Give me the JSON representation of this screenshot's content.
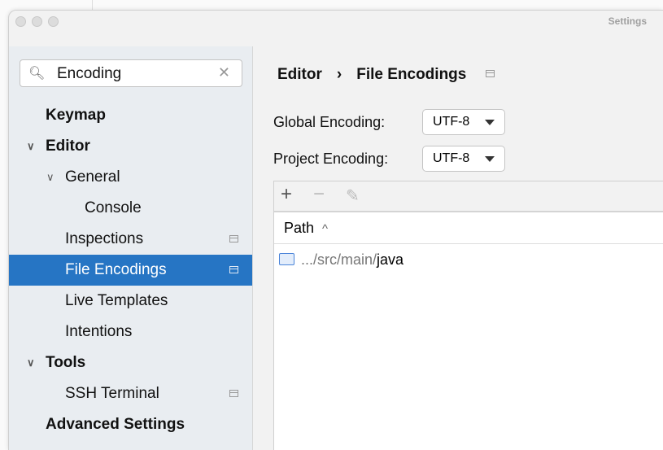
{
  "window": {
    "title": "Settings"
  },
  "search": {
    "value": "Encoding"
  },
  "sidebar": {
    "items": [
      {
        "label": "Keymap",
        "bold": true
      },
      {
        "label": "Editor",
        "bold": true,
        "expanded": true
      },
      {
        "label": "General",
        "expanded": true
      },
      {
        "label": "Console"
      },
      {
        "label": "Inspections"
      },
      {
        "label": "File Encodings",
        "selected": true
      },
      {
        "label": "Live Templates"
      },
      {
        "label": "Intentions"
      },
      {
        "label": "Tools",
        "bold": true,
        "expanded": true
      },
      {
        "label": "SSH Terminal"
      },
      {
        "label": "Advanced Settings",
        "bold": true
      }
    ]
  },
  "breadcrumb": {
    "parent": "Editor",
    "sep": "›",
    "current": "File Encodings"
  },
  "global_encoding": {
    "label": "Global Encoding:",
    "value": "UTF-8"
  },
  "project_encoding": {
    "label": "Project Encoding:",
    "value": "UTF-8"
  },
  "table": {
    "toolbar": {
      "add": "+",
      "remove": "−",
      "edit": "✎"
    },
    "column": "Path",
    "sort_icon": "^",
    "rows": [
      {
        "prefix": ".../src/main/",
        "name": "java"
      }
    ]
  },
  "colors": {
    "selection": "#2675c4",
    "sidebar": "#e9edf1"
  }
}
